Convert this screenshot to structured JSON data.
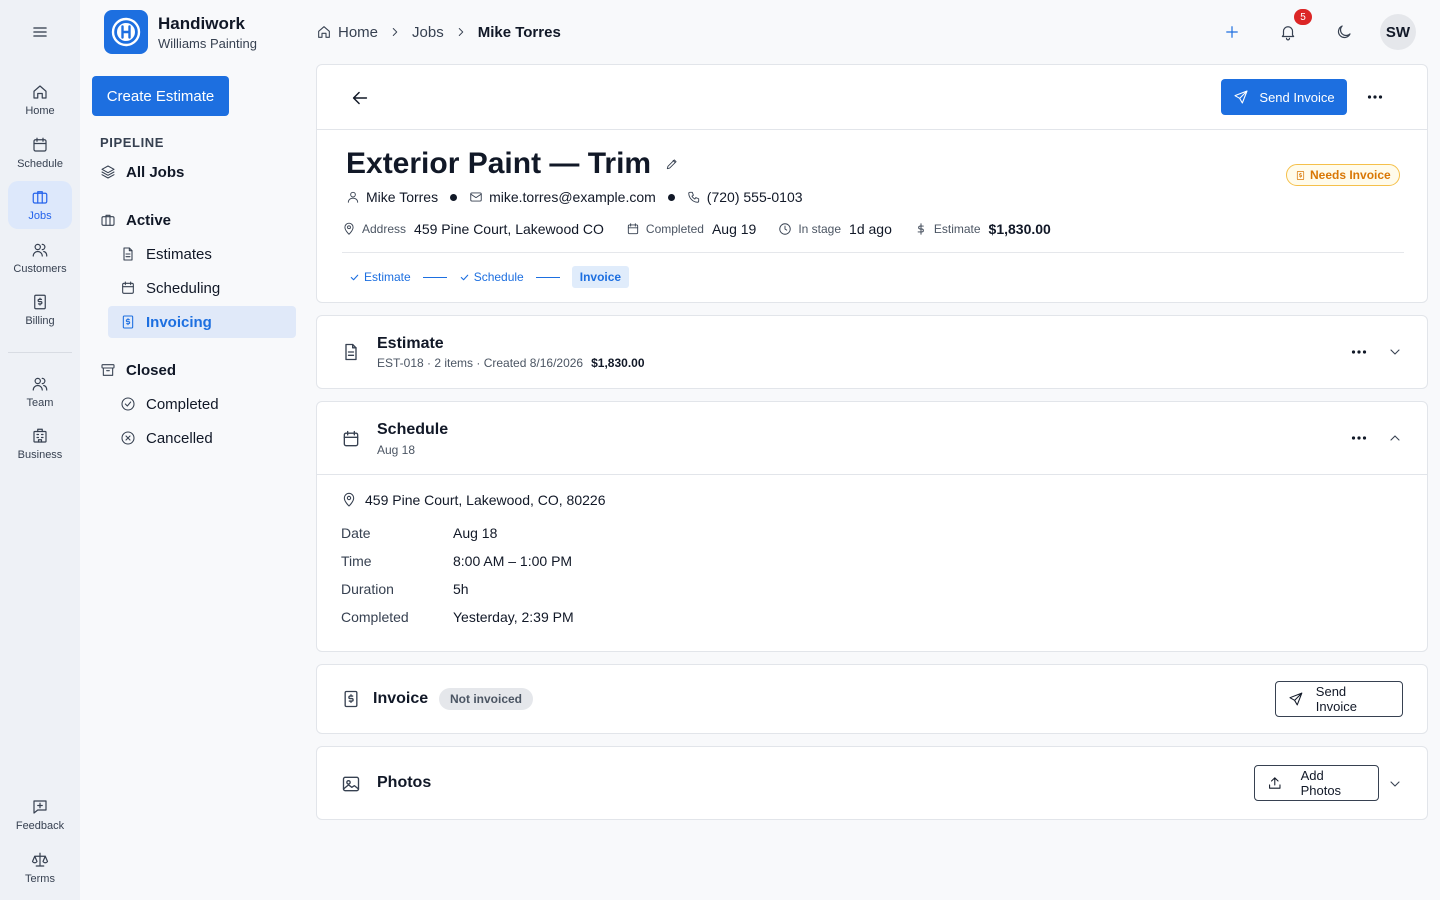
{
  "rail": {
    "items": [
      {
        "label": "Home",
        "icon": "home-icon"
      },
      {
        "label": "Schedule",
        "icon": "calendar-icon"
      },
      {
        "label": "Jobs",
        "icon": "briefcase-icon"
      },
      {
        "label": "Customers",
        "icon": "users-icon"
      },
      {
        "label": "Billing",
        "icon": "receipt-icon"
      },
      {
        "label": "Team",
        "icon": "team-icon"
      },
      {
        "label": "Business",
        "icon": "building-icon"
      },
      {
        "label": "Feedback",
        "icon": "feedback-icon"
      },
      {
        "label": "Terms",
        "icon": "scale-icon"
      }
    ]
  },
  "brand": {
    "name": "Handiwork",
    "company": "Williams Painting",
    "accent": "#1d6fe0"
  },
  "sidebar": {
    "create_label": "Create Estimate",
    "section_label": "PIPELINE",
    "all_jobs": "All Jobs",
    "active": "Active",
    "estimates": "Estimates",
    "scheduling": "Scheduling",
    "invoicing": "Invoicing",
    "closed": "Closed",
    "completed": "Completed",
    "cancelled": "Cancelled"
  },
  "breadcrumb": {
    "home": "Home",
    "jobs": "Jobs",
    "current": "Mike Torres"
  },
  "header": {
    "notification_count": "5",
    "avatar_initials": "SW"
  },
  "job": {
    "send_invoice_label": "Send Invoice",
    "title": "Exterior Paint — Trim",
    "status": "Needs Invoice",
    "customer": "Mike Torres",
    "email": "mike.torres@example.com",
    "phone": "(720) 555-0103",
    "address_label": "Address",
    "address": "459 Pine Court, Lakewood CO",
    "completed_label": "Completed",
    "completed": "Aug 19",
    "in_stage_label": "In stage",
    "in_stage": "1d ago",
    "estimate_label": "Estimate",
    "estimate": "$1,830.00",
    "steps": [
      "Estimate",
      "Schedule",
      "Invoice"
    ]
  },
  "estimate": {
    "title": "Estimate",
    "summary": "EST-018 · 2 items · Created 8/16/2026",
    "amount": "$1,830.00"
  },
  "schedule": {
    "title": "Schedule",
    "date_sub": "Aug 18",
    "address": "459 Pine Court, Lakewood, CO, 80226",
    "rows": [
      {
        "label": "Date",
        "value": "Aug 18"
      },
      {
        "label": "Time",
        "value": "8:00 AM – 1:00 PM"
      },
      {
        "label": "Duration",
        "value": "5h"
      },
      {
        "label": "Completed",
        "value": "Yesterday, 2:39 PM"
      }
    ]
  },
  "invoice": {
    "title": "Invoice",
    "status": "Not invoiced",
    "send_label": "Send Invoice"
  },
  "photos": {
    "title": "Photos",
    "add_label": "Add Photos"
  }
}
